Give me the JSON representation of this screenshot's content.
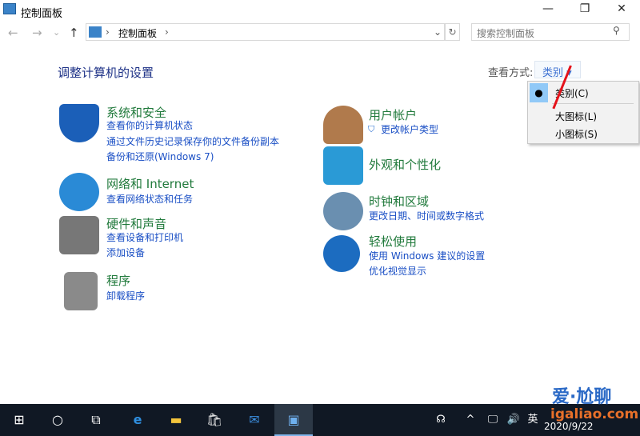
{
  "window": {
    "title": "控制面板",
    "minimize": "—",
    "maximize": "❐",
    "close": "✕"
  },
  "nav": {
    "back": "←",
    "forward": "→",
    "recent": "⌄",
    "up": "↑"
  },
  "address": {
    "path": "控制面板",
    "sep": "›",
    "dropdown": "⌄",
    "refresh": "↻"
  },
  "search": {
    "placeholder": "搜索控制面板",
    "icon": "search-icon"
  },
  "main": {
    "heading": "调整计算机的设置",
    "view_label": "查看方式:",
    "view_value": "类别 ▾"
  },
  "view_menu": {
    "items": [
      {
        "label": "类别(C)",
        "selected": true
      },
      {
        "label": "大图标(L)"
      },
      {
        "label": "小图标(S)"
      }
    ]
  },
  "categories": [
    {
      "title": "系统和安全",
      "links": [
        "查看你的计算机状态",
        "通过文件历史记录保存你的文件备份副本",
        "备份和还原(Windows 7)"
      ],
      "color": "#1b5fb8"
    },
    {
      "title": "网络和 Internet",
      "links": [
        "查看网络状态和任务"
      ],
      "color": "#2a8ad6"
    },
    {
      "title": "硬件和声音",
      "links": [
        "查看设备和打印机",
        "添加设备"
      ],
      "color": "#777777"
    },
    {
      "title": "程序",
      "links": [
        "卸载程序"
      ],
      "color": "#8a8a8a"
    },
    {
      "title": "用户帐户",
      "links": [
        "更改帐户类型"
      ],
      "color": "#b07a4c"
    },
    {
      "title": "外观和个性化",
      "links": [],
      "color": "#2a9ad6"
    },
    {
      "title": "时钟和区域",
      "links": [
        "更改日期、时间或数字格式"
      ],
      "color": "#6a8fb0"
    },
    {
      "title": "轻松使用",
      "links": [
        "使用 Windows 建议的设置",
        "优化视觉显示"
      ],
      "color": "#1c6cc0"
    }
  ],
  "taskbar": {
    "tray": [
      "☊",
      "^",
      "🖵",
      "🔊",
      "英"
    ],
    "date": "2020/9/22"
  },
  "watermark": {
    "cn": "爱·尬聊",
    "url": "igaliao.com"
  }
}
